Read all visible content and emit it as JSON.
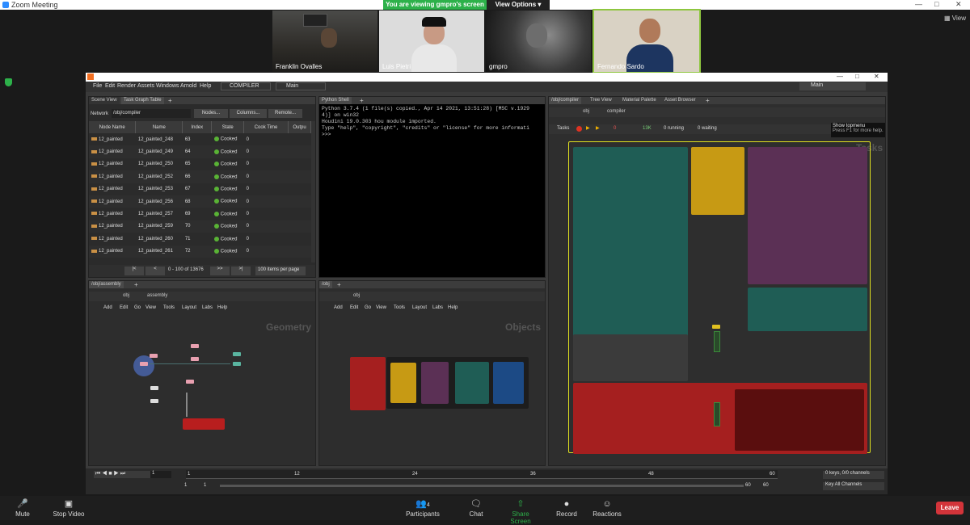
{
  "zoom": {
    "title": "Zoom Meeting",
    "banner_viewing": "You are viewing gmpro's screen",
    "banner_options": "View Options",
    "view_label": "View",
    "participants": [
      {
        "name": "Franklin Ovalles"
      },
      {
        "name": "Luis Pietri"
      },
      {
        "name": "gmpro"
      },
      {
        "name": "Fernando Sardo"
      }
    ],
    "toolbar": {
      "mute": "Mute",
      "stop_video": "Stop Video",
      "participants": "Participants",
      "participants_count": "4",
      "chat": "Chat",
      "share_screen": "Share Screen",
      "record": "Record",
      "reactions": "Reactions",
      "leave": "Leave"
    }
  },
  "houdini": {
    "menu": [
      "File",
      "Edit",
      "Render",
      "Assets",
      "Windows",
      "Arnold",
      "Help"
    ],
    "desktop": "COMPILER",
    "desk_main": "Main",
    "desk_right": "Main",
    "tgt": {
      "tabs": [
        "Scene View",
        "Task Graph Table"
      ],
      "network_label": "Network",
      "network_path": "/obj/compiler",
      "buttons": [
        "Nodes...",
        "Columns...",
        "Remote..."
      ],
      "headers": [
        "Node Name",
        "Name",
        "Index",
        "State",
        "Cook Time",
        "Outpu"
      ],
      "rows": [
        [
          "12_painted",
          "12_painted_248",
          "63",
          "Cooked",
          "0"
        ],
        [
          "12_painted",
          "12_painted_249",
          "64",
          "Cooked",
          "0"
        ],
        [
          "12_painted",
          "12_painted_250",
          "65",
          "Cooked",
          "0"
        ],
        [
          "12_painted",
          "12_painted_252",
          "66",
          "Cooked",
          "0"
        ],
        [
          "12_painted",
          "12_painted_253",
          "67",
          "Cooked",
          "0"
        ],
        [
          "12_painted",
          "12_painted_256",
          "68",
          "Cooked",
          "0"
        ],
        [
          "12_painted",
          "12_painted_257",
          "69",
          "Cooked",
          "0"
        ],
        [
          "12_painted",
          "12_painted_259",
          "70",
          "Cooked",
          "0"
        ],
        [
          "12_painted",
          "12_painted_260",
          "71",
          "Cooked",
          "0"
        ],
        [
          "12_painted",
          "12_painted_261",
          "72",
          "Cooked",
          "0"
        ]
      ],
      "range": "0 - 100 of 13676",
      "per_page": "100 items per page"
    },
    "python": {
      "tab": "Python Shell",
      "text": "Python 3.7.4 (1 file(s) copied., Apr 14 2021, 13:51:28) [MSC v.1929\n4)] on win32\nHoudini 19.0.303 hou module imported.\nType \"help\", \"copyright\", \"credits\" or \"license\" for more informati\n>>>"
    },
    "geo": {
      "tab": "/obj/assembly",
      "path_a": "obj",
      "path_b": "assembly",
      "menu": [
        "Add",
        "Edit",
        "Go",
        "View",
        "Tools",
        "Layout",
        "Labs",
        "Help"
      ],
      "watermark": "Geometry"
    },
    "obj": {
      "tab": "/obj",
      "path_a": "obj",
      "menu": [
        "Add",
        "Edit",
        "Go",
        "View",
        "Tools",
        "Layout",
        "Labs",
        "Help"
      ],
      "watermark": "Objects"
    },
    "compiler": {
      "tabs": [
        "/obj/compiler",
        "Tree View",
        "Material Palette",
        "Asset Browser"
      ],
      "path_a": "obj",
      "path_b": "compiler",
      "tasks_label": "Tasks",
      "count_zero": "0",
      "count_13k": "13K",
      "running": "0 running",
      "waiting": "0 waiting",
      "tooltip_title": "Show topmenu",
      "tooltip_hint": "Press F1 for more help.",
      "watermark": "Tasks"
    },
    "timeline": {
      "frame": "1",
      "ticks": [
        "1",
        "12",
        "24",
        "36",
        "48",
        "60"
      ],
      "start": "1",
      "start2": "1",
      "end": "60",
      "end2": "60",
      "keys": "0 keys, 0/0 channels",
      "key_all": "Key All Channels"
    }
  }
}
